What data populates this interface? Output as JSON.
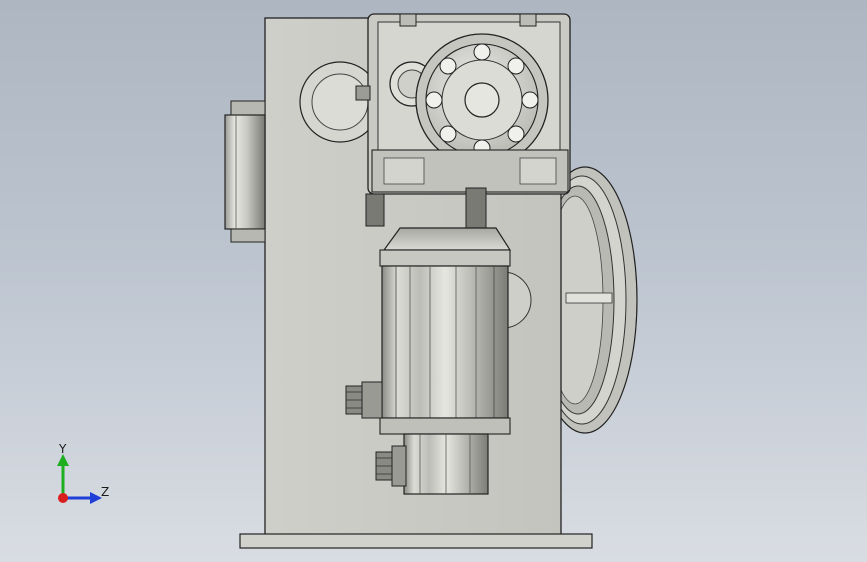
{
  "viewport": {
    "background_top": "#aeb6c2",
    "background_bottom": "#d9dde3"
  },
  "model": {
    "name": "gear-motor-drum-assembly",
    "palette": {
      "body_light": "#d8d8d2",
      "body_mid": "#b8b8b2",
      "body_dark": "#6f6f6a",
      "edge": "#222222"
    }
  },
  "triad": {
    "y_label": "Y",
    "z_label": "Z",
    "y_color": "#1fae1f",
    "z_color": "#1f3fd8",
    "origin_color": "#d81f1f"
  }
}
